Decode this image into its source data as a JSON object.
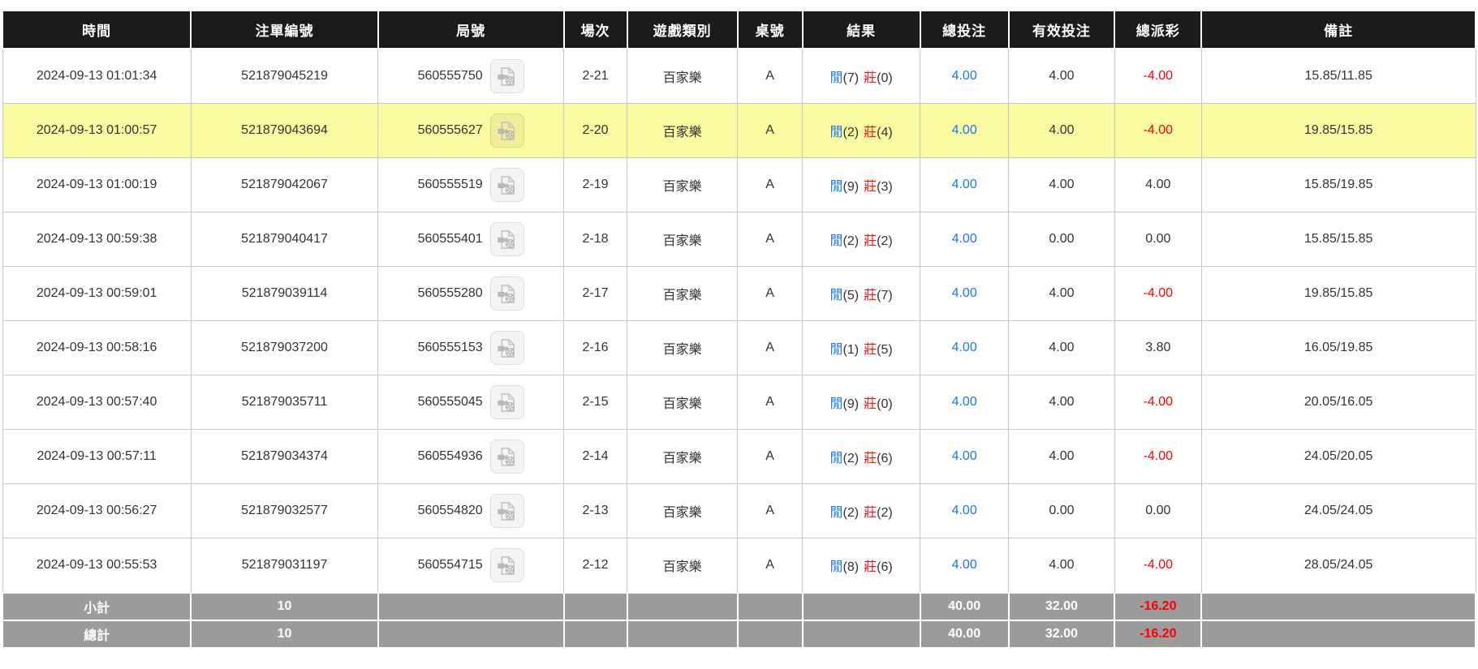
{
  "table": {
    "headers": {
      "time": "時間",
      "bet_id": "注單編號",
      "round_id": "局號",
      "session": "場次",
      "game_type": "遊戲類別",
      "table_no": "桌號",
      "result": "結果",
      "total_bet": "總投注",
      "valid_bet": "有效投注",
      "total_payout": "總派彩",
      "remark": "備註"
    },
    "result_labels": {
      "player": "閒",
      "banker": "莊"
    },
    "icons": {
      "video_icon": "video-file-icon"
    },
    "colors": {
      "header_bg": "#1b1b1b",
      "summary_bg": "#9c9c9c",
      "highlight_bg": "#fafaa0",
      "link_blue": "#1677ff",
      "negative_red": "#ff0000",
      "border_gray": "#c8c8c8"
    },
    "rows": [
      {
        "time": "2024-09-13 01:01:34",
        "bet_id": "521879045219",
        "round_id": "560555750",
        "session": "2-21",
        "game_type": "百家樂",
        "table_no": "A",
        "player_pts": "(7)",
        "banker_pts": "(0)",
        "total_bet": "4.00",
        "valid_bet": "4.00",
        "payout": "-4.00",
        "remark": "15.85/11.85",
        "highlighted": false
      },
      {
        "time": "2024-09-13 01:00:57",
        "bet_id": "521879043694",
        "round_id": "560555627",
        "session": "2-20",
        "game_type": "百家樂",
        "table_no": "A",
        "player_pts": "(2)",
        "banker_pts": "(4)",
        "total_bet": "4.00",
        "valid_bet": "4.00",
        "payout": "-4.00",
        "remark": "19.85/15.85",
        "highlighted": true
      },
      {
        "time": "2024-09-13 01:00:19",
        "bet_id": "521879042067",
        "round_id": "560555519",
        "session": "2-19",
        "game_type": "百家樂",
        "table_no": "A",
        "player_pts": "(9)",
        "banker_pts": "(3)",
        "total_bet": "4.00",
        "valid_bet": "4.00",
        "payout": "4.00",
        "remark": "15.85/19.85",
        "highlighted": false
      },
      {
        "time": "2024-09-13 00:59:38",
        "bet_id": "521879040417",
        "round_id": "560555401",
        "session": "2-18",
        "game_type": "百家樂",
        "table_no": "A",
        "player_pts": "(2)",
        "banker_pts": "(2)",
        "total_bet": "4.00",
        "valid_bet": "0.00",
        "payout": "0.00",
        "remark": "15.85/15.85",
        "highlighted": false
      },
      {
        "time": "2024-09-13 00:59:01",
        "bet_id": "521879039114",
        "round_id": "560555280",
        "session": "2-17",
        "game_type": "百家樂",
        "table_no": "A",
        "player_pts": "(5)",
        "banker_pts": "(7)",
        "total_bet": "4.00",
        "valid_bet": "4.00",
        "payout": "-4.00",
        "remark": "19.85/15.85",
        "highlighted": false
      },
      {
        "time": "2024-09-13 00:58:16",
        "bet_id": "521879037200",
        "round_id": "560555153",
        "session": "2-16",
        "game_type": "百家樂",
        "table_no": "A",
        "player_pts": "(1)",
        "banker_pts": "(5)",
        "total_bet": "4.00",
        "valid_bet": "4.00",
        "payout": "3.80",
        "remark": "16.05/19.85",
        "highlighted": false
      },
      {
        "time": "2024-09-13 00:57:40",
        "bet_id": "521879035711",
        "round_id": "560555045",
        "session": "2-15",
        "game_type": "百家樂",
        "table_no": "A",
        "player_pts": "(9)",
        "banker_pts": "(0)",
        "total_bet": "4.00",
        "valid_bet": "4.00",
        "payout": "-4.00",
        "remark": "20.05/16.05",
        "highlighted": false
      },
      {
        "time": "2024-09-13 00:57:11",
        "bet_id": "521879034374",
        "round_id": "560554936",
        "session": "2-14",
        "game_type": "百家樂",
        "table_no": "A",
        "player_pts": "(2)",
        "banker_pts": "(6)",
        "total_bet": "4.00",
        "valid_bet": "4.00",
        "payout": "-4.00",
        "remark": "24.05/20.05",
        "highlighted": false
      },
      {
        "time": "2024-09-13 00:56:27",
        "bet_id": "521879032577",
        "round_id": "560554820",
        "session": "2-13",
        "game_type": "百家樂",
        "table_no": "A",
        "player_pts": "(2)",
        "banker_pts": "(2)",
        "total_bet": "4.00",
        "valid_bet": "0.00",
        "payout": "0.00",
        "remark": "24.05/24.05",
        "highlighted": false
      },
      {
        "time": "2024-09-13 00:55:53",
        "bet_id": "521879031197",
        "round_id": "560554715",
        "session": "2-12",
        "game_type": "百家樂",
        "table_no": "A",
        "player_pts": "(8)",
        "banker_pts": "(6)",
        "total_bet": "4.00",
        "valid_bet": "4.00",
        "payout": "-4.00",
        "remark": "28.05/24.05",
        "highlighted": false
      }
    ],
    "footer": [
      {
        "label": "小計",
        "count": "10",
        "total_bet": "40.00",
        "valid_bet": "32.00",
        "payout": "-16.20"
      },
      {
        "label": "總計",
        "count": "10",
        "total_bet": "40.00",
        "valid_bet": "32.00",
        "payout": "-16.20"
      }
    ]
  }
}
